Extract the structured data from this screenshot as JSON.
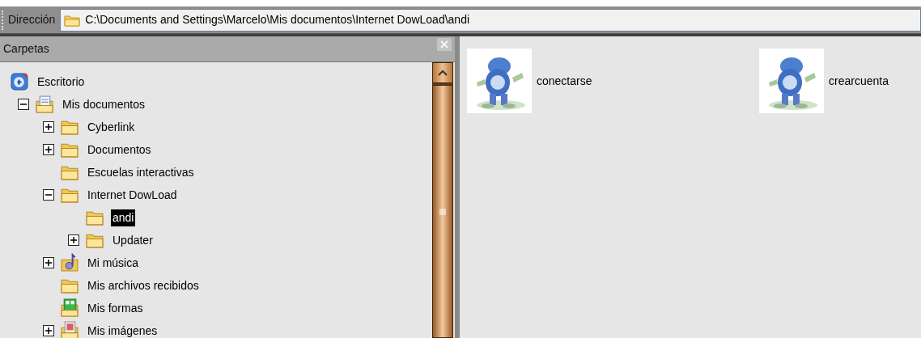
{
  "address_bar": {
    "label": "Dirección",
    "value": "C:\\Documents and Settings\\Marcelo\\Mis documentos\\Internet DowLoad\\andi"
  },
  "folders_pane": {
    "title": "Carpetas",
    "tree": [
      {
        "label": "Escritorio",
        "kind": "desktop",
        "selected": false,
        "children": [
          {
            "label": "Mis documentos",
            "kind": "documents",
            "expanded": true,
            "selected": false,
            "children": [
              {
                "label": "Cyberlink",
                "kind": "folder",
                "expanded": false,
                "selected": false
              },
              {
                "label": "Documentos",
                "kind": "folder",
                "expanded": false,
                "selected": false
              },
              {
                "label": "Escuelas interactivas",
                "kind": "folder",
                "selected": false
              },
              {
                "label": "Internet DowLoad",
                "kind": "folder",
                "expanded": true,
                "selected": false,
                "children": [
                  {
                    "label": "andi",
                    "kind": "folder",
                    "selected": true
                  },
                  {
                    "label": "Updater",
                    "kind": "folder",
                    "expanded": false,
                    "selected": false
                  }
                ]
              },
              {
                "label": "Mi música",
                "kind": "music",
                "expanded": false,
                "selected": false
              },
              {
                "label": "Mis archivos recibidos",
                "kind": "folder",
                "selected": false
              },
              {
                "label": "Mis formas",
                "kind": "forms",
                "selected": false
              },
              {
                "label": "Mis imágenes",
                "kind": "pictures",
                "expanded": false,
                "selected": false
              }
            ]
          }
        ]
      }
    ]
  },
  "files": [
    {
      "name": "conectarse",
      "kind": "picture"
    },
    {
      "name": "crearcuenta",
      "kind": "picture"
    }
  ]
}
